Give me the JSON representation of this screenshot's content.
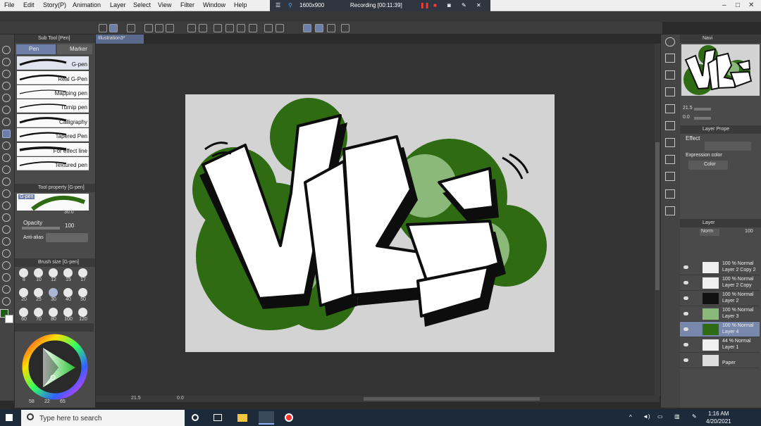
{
  "app": {
    "menus": [
      "File",
      "Edit",
      "Story(P)",
      "Animation",
      "Layer",
      "Select",
      "View",
      "Filter",
      "Window",
      "Help"
    ],
    "recording": {
      "resolution": "1600x900",
      "status": "Recording [00:11:39]"
    }
  },
  "doc_tab": "Illustration3*",
  "sub_tool": {
    "title": "Sub Tool [Pen]",
    "tabs": [
      "Pen",
      "Marker"
    ],
    "brushes": [
      "G-pen",
      "Real G-Pen",
      "Mapping pen",
      "Turnip pen",
      "Calligraphy",
      "Tapered Pen",
      "For effect line",
      "Textured pen"
    ]
  },
  "tool_property": {
    "title": "Tool property [G-pen]",
    "brush_label": "G-pen",
    "size_value": "30.0",
    "opacity_label": "Opacity",
    "opacity_value": "100",
    "antialias_label": "Anti-alias"
  },
  "brush_size": {
    "title": "Brush size [G-pen]",
    "sizes": [
      "8",
      "10",
      "12",
      "15",
      "17",
      "20",
      "25",
      "30",
      "40",
      "50",
      "60",
      "70",
      "80",
      "100",
      "120"
    ]
  },
  "color_readout": {
    "a": "58",
    "b": "22",
    "c": "65"
  },
  "canvas": {
    "zoom": "21.5",
    "rotation": "0.0"
  },
  "navigator": {
    "title": "Navi",
    "zoom": "21.5",
    "angle": "0.0"
  },
  "layer_property": {
    "title": "Layer Prope",
    "effect_label": "Effect",
    "expression_label": "Expression color",
    "expression_value": "Color"
  },
  "layers_panel": {
    "title": "Layer",
    "blend": "Norm",
    "opacity": "100",
    "layers": [
      {
        "l1": "100 % Normal",
        "l2": "Layer 2 Copy 2"
      },
      {
        "l1": "100 % Normal",
        "l2": "Layer 2 Copy"
      },
      {
        "l1": "100 % Normal",
        "l2": "Layer 2"
      },
      {
        "l1": "100 % Normal",
        "l2": "Layer 3"
      },
      {
        "l1": "100 % Normal",
        "l2": "Layer 4"
      },
      {
        "l1": "44 % Normal",
        "l2": "Layer 1"
      },
      {
        "l1": "",
        "l2": "Paper"
      }
    ]
  },
  "artwork_text": "VIZES",
  "taskbar": {
    "search_placeholder": "Type here to search",
    "time": "1:16 AM",
    "date": "4/20/2021"
  },
  "colors": {
    "accent": "#6d7fa8",
    "leaf_green": "#2e6b12",
    "light_green": "#8bb97a"
  }
}
